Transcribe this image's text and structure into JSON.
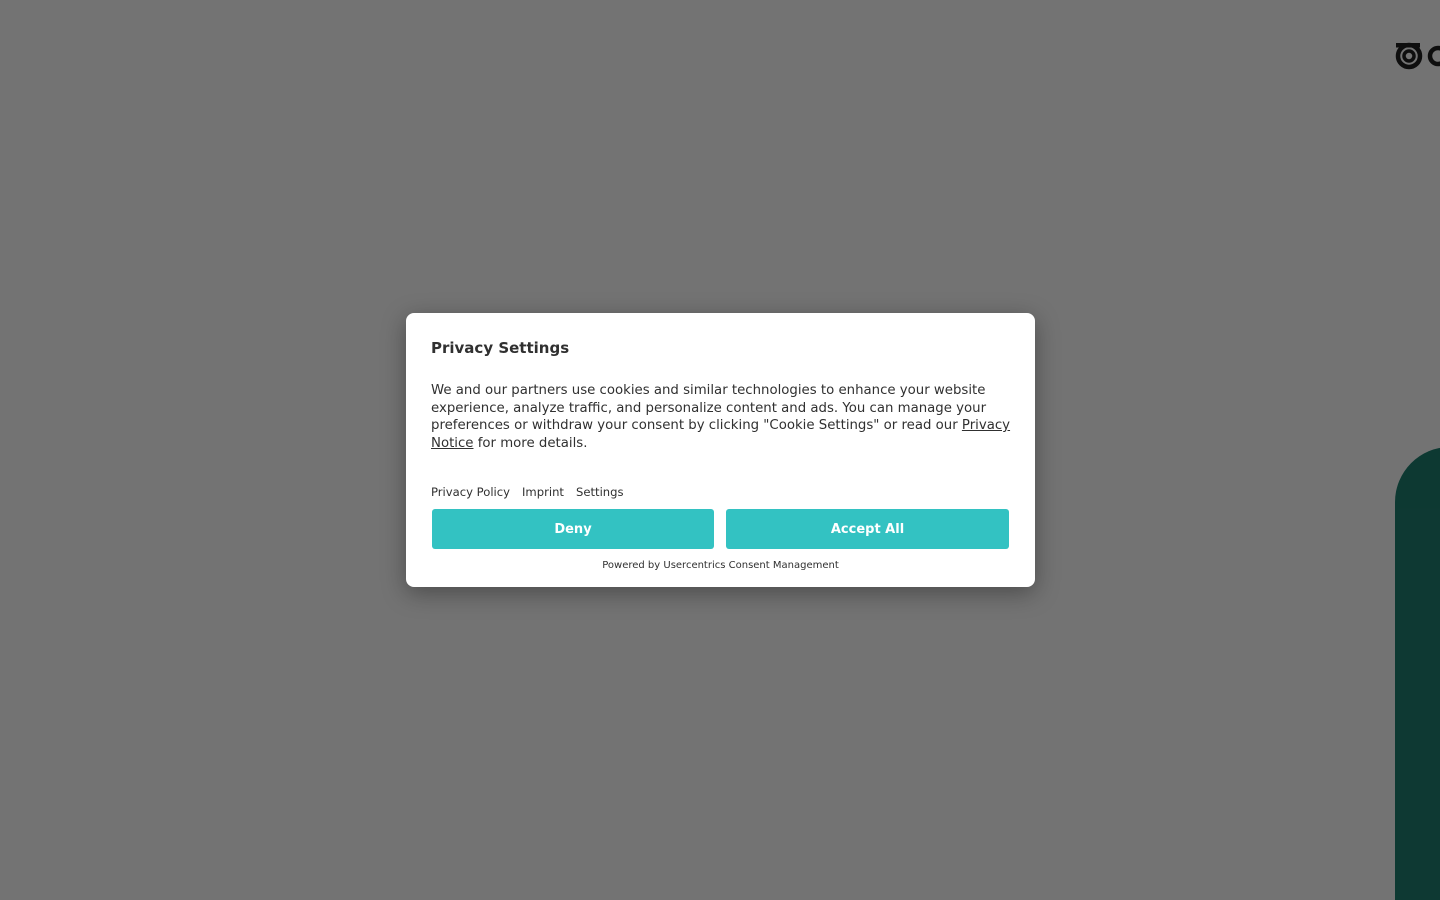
{
  "colors": {
    "overlay": "#737373",
    "side_panel": "#264f4b",
    "button": "#33c2c2",
    "dialog_background": "#ffffff",
    "text": "#303030"
  },
  "background": {
    "logo_icon": "brand-logo-icon"
  },
  "dialog": {
    "title": "Privacy Settings",
    "body_before_link": "We and our partners use cookies and similar technologies to enhance your website experience, analyze traffic, and personalize content and ads. You can manage your preferences or withdraw your consent by clicking \"Cookie Settings\" or read our ",
    "body_link": "Privacy Notice",
    "body_after_link": " for more details.",
    "links": {
      "privacy_policy": "Privacy Policy",
      "imprint": "Imprint",
      "settings": "Settings"
    },
    "buttons": {
      "deny": "Deny",
      "accept_all": "Accept All"
    },
    "powered_by": "Powered by Usercentrics Consent Management"
  }
}
